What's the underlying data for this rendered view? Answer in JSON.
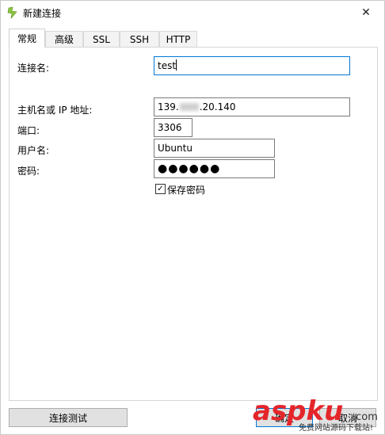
{
  "window": {
    "title": "新建连接",
    "close_glyph": "✕"
  },
  "tabs": [
    {
      "label": "常规",
      "active": true
    },
    {
      "label": "高级"
    },
    {
      "label": "SSL"
    },
    {
      "label": "SSH"
    },
    {
      "label": "HTTP"
    }
  ],
  "form": {
    "connection_name_label": "连接名:",
    "connection_name_value": "test",
    "host_label": "主机名或 IP 地址:",
    "host_prefix": "139.",
    "host_suffix": ".20.140",
    "port_label": "端口:",
    "port_value": "3306",
    "user_label": "用户名:",
    "user_value": "Ubuntu",
    "password_label": "密码:",
    "password_value": "●●●●●●",
    "save_password_label": "保存密码",
    "save_password_checked": true
  },
  "buttons": {
    "test_connection": "连接测试",
    "ok": "确定",
    "cancel": "取消"
  },
  "watermark": {
    "brand": "aspku",
    "tld": ".com",
    "caption": "免费网站源码下载站!"
  },
  "colors": {
    "focus": "#0078d7",
    "watermark_red": "#e4262b"
  }
}
